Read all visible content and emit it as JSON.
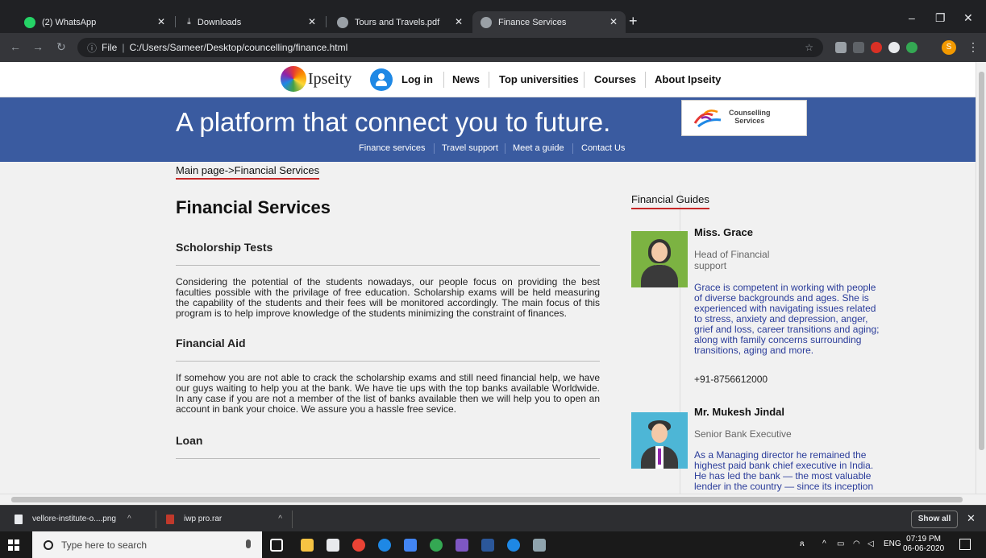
{
  "browser": {
    "tabs": [
      {
        "title": "(2) WhatsApp",
        "favicon": "whatsapp-icon",
        "active": false
      },
      {
        "title": "Downloads",
        "favicon": "download-icon",
        "active": false
      },
      {
        "title": "Tours and Travels.pdf",
        "favicon": "globe-icon",
        "active": false
      },
      {
        "title": "Finance Services",
        "favicon": "globe-icon",
        "active": true
      }
    ],
    "address": {
      "scheme_label": "File",
      "url": "C:/Users/Sameer/Desktop/councelling/finance.html"
    },
    "profile_initial": "S"
  },
  "site": {
    "logo_text": "Ipseity",
    "nav": [
      "Log in",
      "News",
      "Top universities",
      "Courses",
      "About Ipseity"
    ],
    "hero_title": "A platform that connect you to future.",
    "badge_line1": "Counselling",
    "badge_line2": "Services",
    "subnav": [
      "Finance services",
      "Travel support",
      "Meet a guide",
      "Contact Us"
    ],
    "breadcrumb": "Main page->Financial Services"
  },
  "main": {
    "title": "Financial Services",
    "sections": [
      {
        "heading": "Scholorship Tests",
        "body": "Considering the potential of the students nowadays, our people focus on providing the best faculties possible with the privilage of free education. Scholarship exams will be held measuring the capability of the students and their fees will be monitored accordingly. The main focus of this program is to help improve knowledge of the students minimizing the constraint of finances."
      },
      {
        "heading": "Financial Aid",
        "body": "If somehow you are not able to crack the scholarship exams and still need financial help, we have our guys waiting to help you at the bank. We have tie ups with the top banks available Worldwide. In any case if you are not a member of the list of banks available then we will help you to open an account in bank your choice. We assure you a hassle free sevice."
      },
      {
        "heading": "Loan",
        "body": ""
      }
    ]
  },
  "sidebar": {
    "heading": "Financial Guides",
    "guides": [
      {
        "name": "Miss. Grace",
        "role": "Head of Financial support",
        "description": "Grace is competent in working with people of diverse backgrounds and ages. She is experienced with navigating issues related to stress, anxiety and depression, anger, grief and loss, career transitions and aging; along with family concerns surrounding transitions, aging and more.",
        "phone": "+91-8756612000"
      },
      {
        "name": "Mr. Mukesh Jindal",
        "role": "Senior Bank Executive",
        "description": "As a Managing director he remained the highest paid bank chief executive in India. He has led the bank — the most valuable lender in the country — since its inception",
        "phone": ""
      }
    ]
  },
  "downloads": {
    "items": [
      {
        "name": "vellore-institute-o....png"
      },
      {
        "name": "iwp pro.rar"
      }
    ],
    "show_all": "Show all"
  },
  "taskbar": {
    "search_placeholder": "Type here to search",
    "language": "ENG",
    "time": "07:19 PM",
    "date": "06-06-2020"
  },
  "colors": {
    "hero_bg": "#3a5ba0",
    "accent_red": "#c62828",
    "guide_text": "#2a3c9a"
  }
}
